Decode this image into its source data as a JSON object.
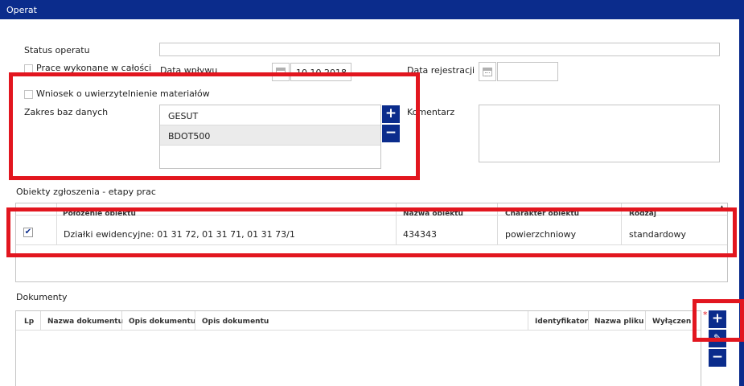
{
  "window": {
    "title": "Operat"
  },
  "form": {
    "status_label": "Status operatu",
    "status_value": "",
    "prace_label": "Prace wykonane w całości",
    "data_wplywu_label": "Data wpływu",
    "data_wplywu_value": "10.10.2018",
    "data_rejestracji_label": "Data rejestracji",
    "data_rejestracji_value": "",
    "wniosek_label": "Wniosek o uwierzytelnienie materiałów",
    "zakres_label": "Zakres baz danych",
    "zakres_items": [
      "GESUT",
      "BDOT500"
    ],
    "komentarz_label": "Komentarz",
    "komentarz_value": ""
  },
  "obiekty": {
    "title": "Obiekty zgłoszenia - etapy prac",
    "columns": [
      "Położenie obiektu",
      "Nazwa obiektu",
      "Charakter obiektu",
      "Rodzaj"
    ],
    "rows": [
      {
        "checked": true,
        "polozenie": "Działki ewidencyjne: 01 31 72, 01 31 71, 01 31 73/1",
        "nazwa": "434343",
        "charakter": "powierzchniowy",
        "rodzaj": "standardowy"
      }
    ]
  },
  "dokumenty": {
    "title": "Dokumenty",
    "columns": [
      "Lp",
      "Nazwa dokumentu",
      "Opis dokumentu",
      "Opis dokumentu",
      "Identyfikator",
      "Nazwa pliku",
      "Wyłączen"
    ]
  },
  "buttons": {
    "add": "+",
    "remove": "−",
    "edit": "✎"
  },
  "colors": {
    "header": "#0b2c8c",
    "highlight": "#e2161f"
  }
}
